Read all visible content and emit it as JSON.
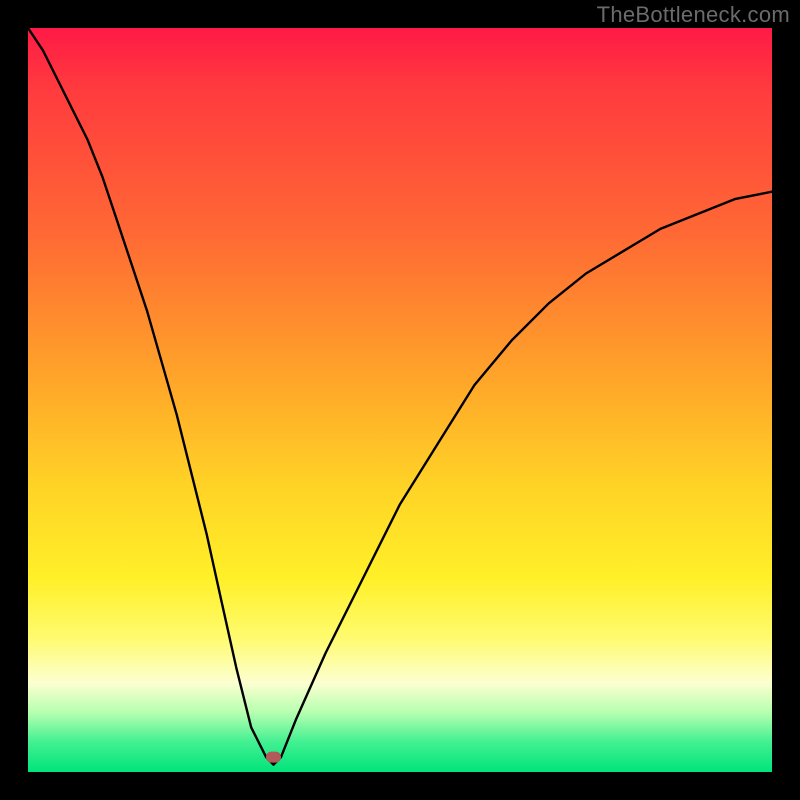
{
  "watermark": "TheBottleneck.com",
  "chart_data": {
    "type": "line",
    "title": "",
    "xlabel": "",
    "ylabel": "",
    "xlim": [
      0,
      100
    ],
    "ylim": [
      0,
      100
    ],
    "grid": false,
    "legend": false,
    "gradient_stops": [
      {
        "pos": 0,
        "color": "#ff1a46"
      },
      {
        "pos": 8,
        "color": "#ff3a3e"
      },
      {
        "pos": 28,
        "color": "#ff6a34"
      },
      {
        "pos": 48,
        "color": "#ffa829"
      },
      {
        "pos": 62,
        "color": "#ffd426"
      },
      {
        "pos": 74,
        "color": "#fff028"
      },
      {
        "pos": 82,
        "color": "#fffb6f"
      },
      {
        "pos": 88,
        "color": "#fcffd0"
      },
      {
        "pos": 92,
        "color": "#b6ffb0"
      },
      {
        "pos": 96,
        "color": "#42f091"
      },
      {
        "pos": 100,
        "color": "#00e47a"
      }
    ],
    "series": [
      {
        "name": "curve",
        "x": [
          0,
          2,
          4,
          6,
          8,
          10,
          12,
          14,
          16,
          18,
          20,
          22,
          24,
          26,
          28,
          30,
          32,
          33,
          34,
          36,
          40,
          45,
          50,
          55,
          60,
          65,
          70,
          75,
          80,
          85,
          90,
          95,
          100
        ],
        "values": [
          100,
          97,
          93,
          89,
          85,
          80,
          74,
          68,
          62,
          55,
          48,
          40,
          32,
          23,
          14,
          6,
          2,
          1,
          2,
          7,
          16,
          26,
          36,
          44,
          52,
          58,
          63,
          67,
          70,
          73,
          75,
          77,
          78
        ]
      }
    ],
    "marker": {
      "x": 33,
      "y": 2,
      "color": "#b05a5a",
      "shape": "rounded-rect"
    }
  }
}
